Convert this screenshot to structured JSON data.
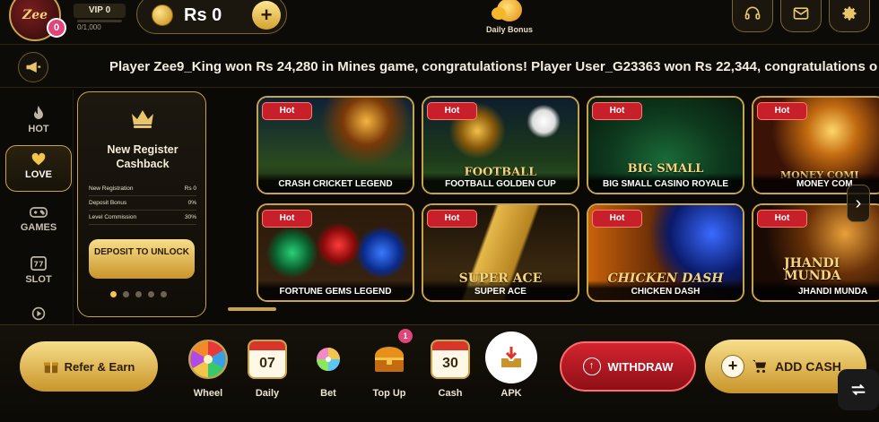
{
  "header": {
    "vip_label": "VIP 0",
    "vip_progress": "0/1,000",
    "avatar_badge": "0",
    "avatar_logo_text": "Zee",
    "balance": "Rs 0",
    "add_symbol": "+",
    "daily_bonus_label": "Daily Bonus",
    "icons": [
      "headset-icon",
      "mail-icon",
      "gear-icon"
    ]
  },
  "ticker": {
    "text": "Player Zee9_King won Rs 24,280 in Mines game, congratulations! Player User_G23363 won Rs 22,344, congratulations o"
  },
  "categories": [
    {
      "label": "HOT",
      "icon": "flame-icon",
      "active": false
    },
    {
      "label": "LOVE",
      "icon": "heart-icon",
      "active": true
    },
    {
      "label": "GAMES",
      "icon": "gamepad-icon",
      "active": false
    },
    {
      "label": "SLOT",
      "icon": "slot-777-icon",
      "active": false
    }
  ],
  "promo": {
    "title": "New Register Cashback",
    "rows": [
      {
        "label": "New Registration",
        "value": "Rs 0"
      },
      {
        "label": "Deposit Bonus",
        "value": "0%"
      },
      {
        "label": "Level Commission",
        "value": "30%"
      }
    ],
    "button": "DEPOSIT TO UNLOCK",
    "dot_count": 5,
    "active_dot": 0
  },
  "games": [
    {
      "title": "CRASH CRICKET LEGEND",
      "badge": "Hot",
      "art_text": ""
    },
    {
      "title": "FOOTBALL GOLDEN CUP",
      "badge": "Hot",
      "art_text": "FOOTBALL"
    },
    {
      "title": "BIG SMALL CASINO ROYALE",
      "badge": "Hot",
      "art_text": "BIG SMALL"
    },
    {
      "title": "MONEY COM",
      "badge": "Hot",
      "art_text": "MONEY COMI"
    },
    {
      "title": "FORTUNE GEMS LEGEND",
      "badge": "Hot",
      "art_text": ""
    },
    {
      "title": "SUPER ACE",
      "badge": "Hot",
      "art_text": "SUPER ACE"
    },
    {
      "title": "CHICKEN DASH",
      "badge": "Hot",
      "art_text": "CHICKEN DASH"
    },
    {
      "title": "JHANDI MUNDA",
      "badge": "Hot",
      "art_text": "JHANDI MUNDA"
    }
  ],
  "bottom": {
    "refer_label": "Refer & Earn",
    "items": [
      {
        "label": "Wheel",
        "icon": "wheel-icon"
      },
      {
        "label": "Daily",
        "icon": "calendar-icon",
        "number": "07"
      },
      {
        "label": "Bet",
        "icon": "bet-wheel-icon"
      },
      {
        "label": "Top Up",
        "icon": "treasure-chest-icon",
        "badge": "1"
      },
      {
        "label": "Cash",
        "icon": "calendar-icon",
        "number": "30"
      },
      {
        "label": "APK",
        "icon": "download-tray-icon"
      }
    ],
    "withdraw_label": "WITHDRAW",
    "addcash_label": "ADD CASH"
  },
  "colors": {
    "gold": "#c9a34a",
    "hot_red": "#c8202a",
    "withdraw_red": "#d4242f",
    "background": "#0b0906"
  }
}
